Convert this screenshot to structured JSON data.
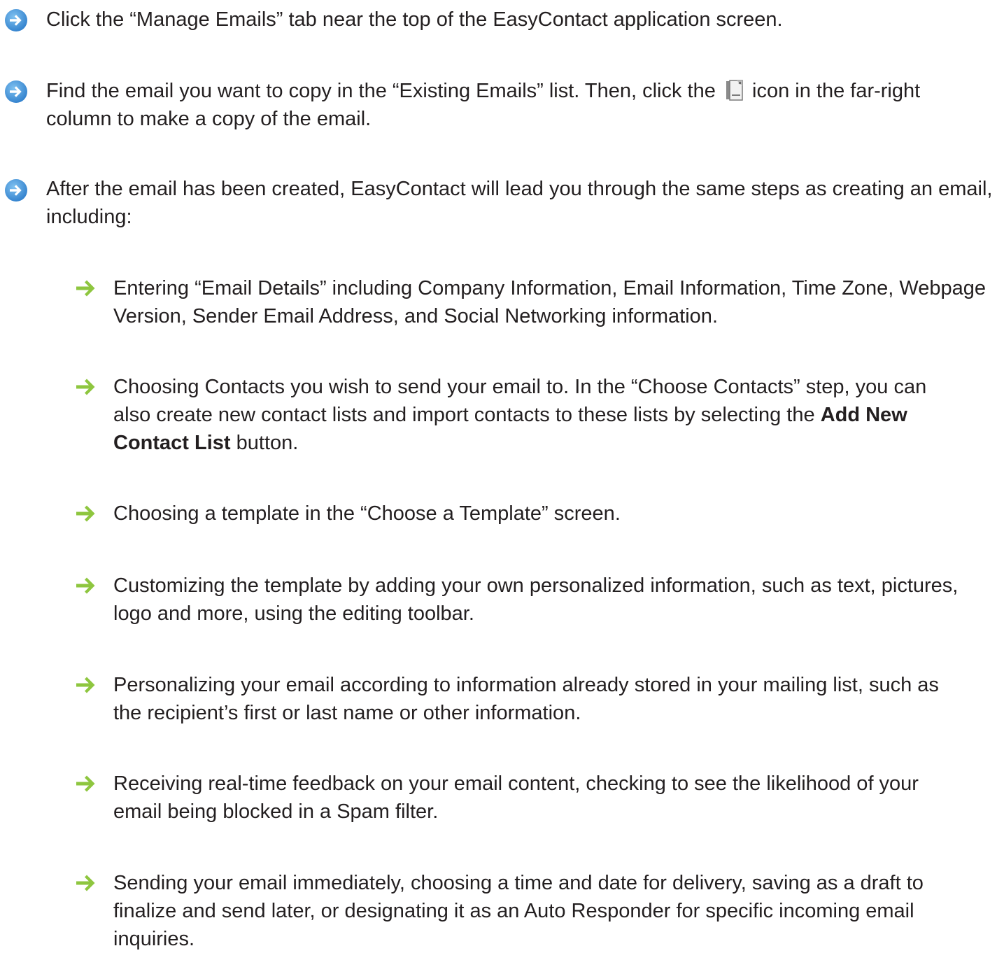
{
  "steps": [
    {
      "text": "Click the “Manage Emails” tab near the top of the EasyContact application screen."
    },
    {
      "text_before_icon": "Find the email you want to copy in the “Existing Emails” list. Then, click the",
      "inline_icon": "copy-email-icon",
      "text_after_icon": "icon in the far-right column to make a copy of the email."
    },
    {
      "text": "After the email has been created, EasyContact will lead you through the same steps as creating an email, including:"
    }
  ],
  "sub_steps": [
    {
      "text": "Entering “Email Details” including Company Information, Email Information, Time Zone, Webpage Version, Sender Email Address, and Social Networking information."
    },
    {
      "text_before_bold": "Choosing Contacts you wish to send your email to. In the “Choose Contacts” step, you can also create new contact lists and import contacts to these lists by selecting the",
      "bold": "Add New Contact List",
      "text_after_bold": "button."
    },
    {
      "text": "Choosing a template in the “Choose a Template” screen."
    },
    {
      "text": "Customizing the template by adding your own personalized information, such as text, pictures, logo and more, using the editing toolbar."
    },
    {
      "text": "Personalizing your email according to information already stored in your mailing list, such as the recipient’s first or last name or other information."
    },
    {
      "text": "Receiving real-time feedback on your email content, checking to see the likelihood of your email being blocked in a Spam filter."
    },
    {
      "text": "Sending your email immediately, choosing a time and date for delivery, saving as a draft to finalize and send later, or designating it as an Auto Responder for specific incoming email inquiries."
    }
  ],
  "icons": {
    "step": "blue-circle-arrow-icon",
    "sub_step": "green-arrow-icon",
    "copy": "copy-email-icon"
  },
  "colors": {
    "text": "#231f20",
    "step_icon": "#3d8fd6",
    "sub_step_icon": "#8ec63f"
  }
}
